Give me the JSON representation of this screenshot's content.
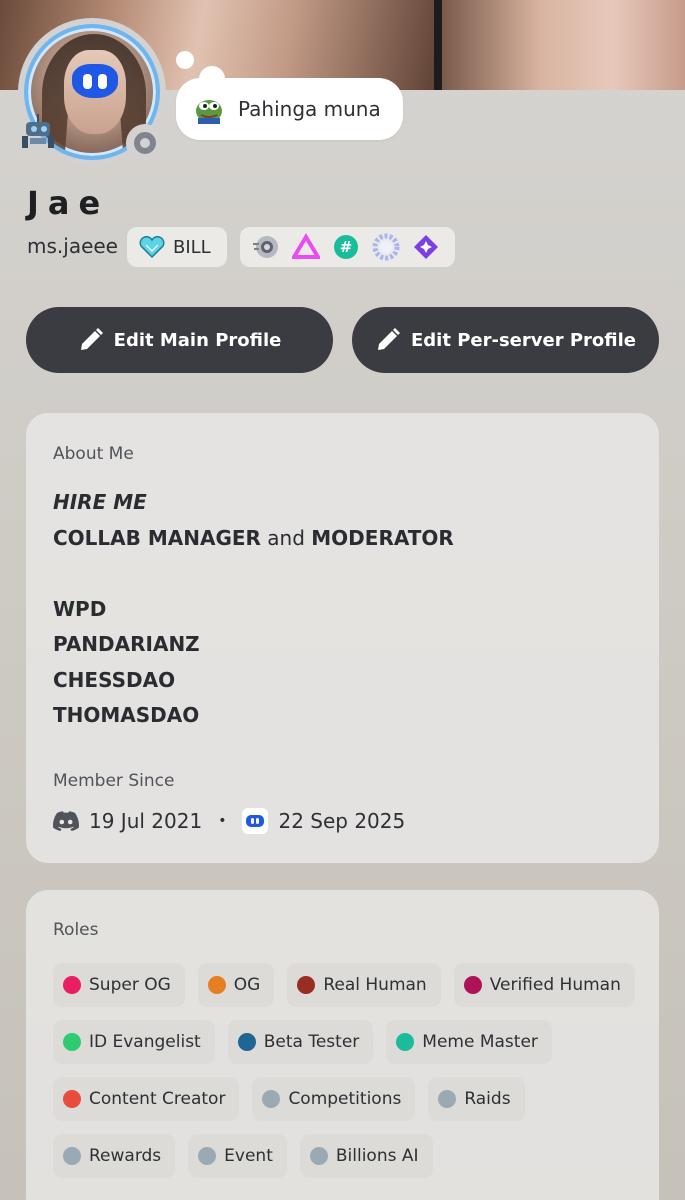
{
  "status": {
    "text": "Pahinga muna"
  },
  "profile": {
    "display_name": "Jae",
    "username": "ms.jaeee",
    "guild_tag": "BILL"
  },
  "buttons": {
    "edit_main": "Edit Main Profile",
    "edit_server": "Edit Per-server Profile"
  },
  "about": {
    "title": "About Me",
    "line1": "HIRE ME",
    "line2_a": "COLLAB MANAGER",
    "line2_b": " and ",
    "line2_c": "MODERATOR",
    "line4": "WPD",
    "line5": "PANDARIANZ",
    "line6": "CHESSDAO",
    "line7": "THOMASDAO"
  },
  "member_since": {
    "title": "Member Since",
    "discord_date": "19 Jul 2021",
    "separator": "•",
    "server_date": "22 Sep 2025"
  },
  "roles": {
    "title": "Roles",
    "items": [
      {
        "label": "Super OG",
        "color": "#e91e63"
      },
      {
        "label": "OG",
        "color": "#e67e22"
      },
      {
        "label": "Real Human",
        "color": "#992d22"
      },
      {
        "label": "Verified Human",
        "color": "#ad1457"
      },
      {
        "label": "ID Evangelist",
        "color": "#2ecc71"
      },
      {
        "label": "Beta Tester",
        "color": "#206694"
      },
      {
        "label": "Meme Master",
        "color": "#1abc9c"
      },
      {
        "label": "Content Creator",
        "color": "#e74c3c"
      },
      {
        "label": "Competitions",
        "color": "#99aab5"
      },
      {
        "label": "Raids",
        "color": "#99aab5"
      },
      {
        "label": "Rewards",
        "color": "#99aab5"
      },
      {
        "label": "Event",
        "color": "#99aab5"
      },
      {
        "label": "Billions AI",
        "color": "#99aab5"
      }
    ]
  },
  "icons": {
    "badges": [
      "nitro-boost-icon",
      "triangle-badge-icon",
      "hashtag-badge-icon",
      "quest-badge-icon",
      "diamond-badge-icon"
    ]
  }
}
